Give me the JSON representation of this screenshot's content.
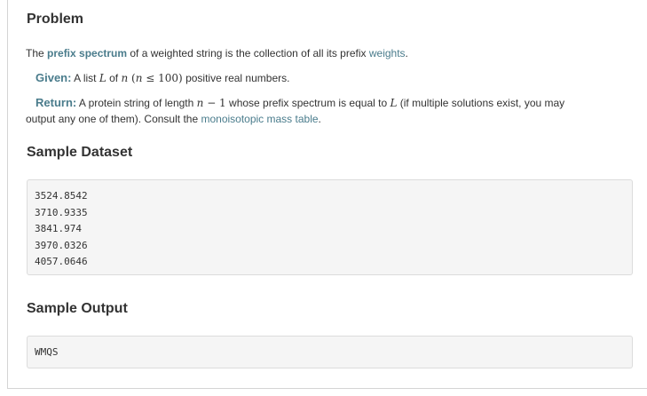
{
  "problem": {
    "title": "Problem",
    "intro": {
      "text1": "The ",
      "link_prefix_spectrum": "prefix spectrum",
      "text2": " of a weighted string is the collection of all its prefix ",
      "link_weights": "weights",
      "text3": "."
    },
    "given": {
      "label": "Given:",
      "text1": " A list ",
      "math_L": "L",
      "text2": " of ",
      "math_n": "n",
      "math_cond_open": " (",
      "math_cond_n": "n",
      "math_cond_rest": " ≤ 100)",
      "text3": " positive real numbers."
    },
    "return": {
      "label": "Return:",
      "text1": " A protein string of length ",
      "math_n": "n",
      "math_minus": " − 1",
      "text2": " whose prefix spectrum is equal to ",
      "math_L": "L",
      "text3": " (if multiple solutions exist, you may",
      "text4": "output any one of them). Consult the ",
      "link_mass_table": "monoisotopic mass table",
      "text5": "."
    }
  },
  "sample_dataset": {
    "title": "Sample Dataset",
    "lines": [
      "3524.8542",
      "3710.9335",
      "3841.974",
      "3970.0326",
      "4057.0646"
    ]
  },
  "sample_output": {
    "title": "Sample Output",
    "lines": [
      "WMQS"
    ]
  },
  "colors": {
    "link": "#4a7c8c",
    "text": "#333333",
    "code_bg": "#f5f5f5",
    "border": "#d4d4d4"
  }
}
